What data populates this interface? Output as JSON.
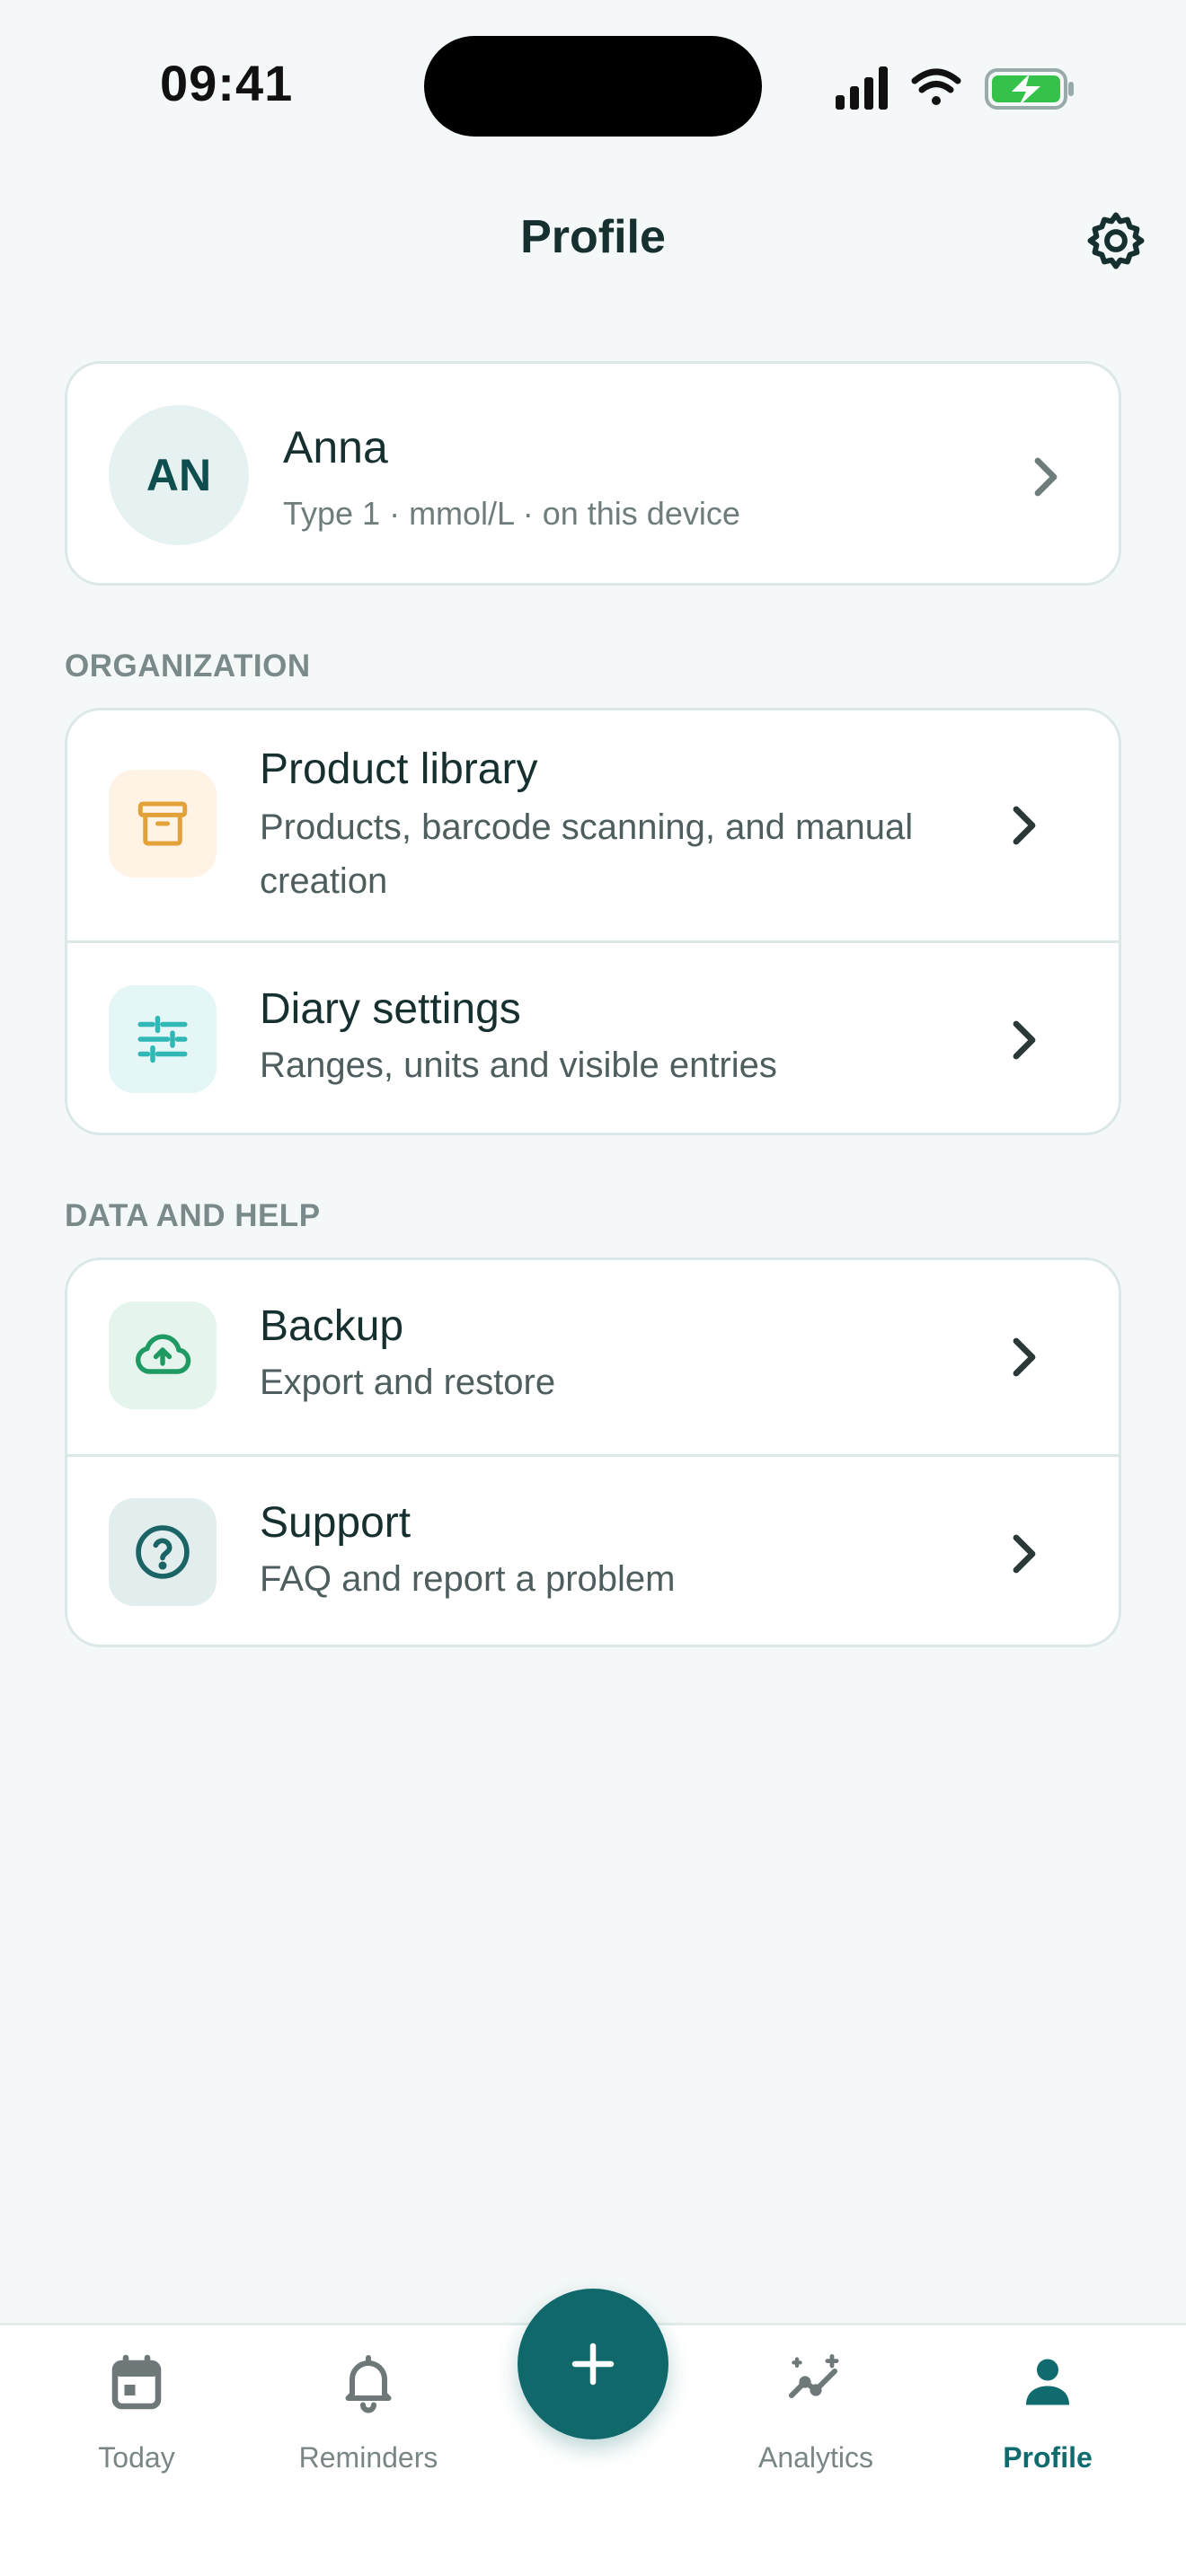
{
  "status_bar": {
    "time": "09:41"
  },
  "header": {
    "title": "Profile"
  },
  "profile": {
    "initials": "AN",
    "name": "Anna",
    "meta": "Type 1 · mmol/L · on this device"
  },
  "sections": {
    "organization": {
      "label": "ORGANIZATION",
      "items": [
        {
          "title": "Product library",
          "subtitle": "Products, barcode scanning, and manual creation",
          "icon": "archive-box-icon"
        },
        {
          "title": "Diary settings",
          "subtitle": "Ranges, units and visible entries",
          "icon": "sliders-icon"
        }
      ]
    },
    "data_help": {
      "label": "DATA AND HELP",
      "items": [
        {
          "title": "Backup",
          "subtitle": "Export and restore",
          "icon": "cloud-upload-icon"
        },
        {
          "title": "Support",
          "subtitle": "FAQ and report a problem",
          "icon": "question-circle-icon"
        }
      ]
    }
  },
  "tabbar": {
    "tabs": [
      {
        "label": "Today",
        "icon": "calendar-icon",
        "active": false
      },
      {
        "label": "Reminders",
        "icon": "bell-icon",
        "active": false
      },
      {
        "label": "Analytics",
        "icon": "trend-sparkle-icon",
        "active": false
      },
      {
        "label": "Profile",
        "icon": "person-icon",
        "active": true
      }
    ],
    "fab_icon": "plus-icon"
  },
  "colors": {
    "accent": "#10686B",
    "background": "#F4F8F8",
    "product_icon": "#E3A13A",
    "diary_icon": "#2FB8B5",
    "backup_icon": "#1E9A62",
    "support_icon": "#1A6466"
  }
}
